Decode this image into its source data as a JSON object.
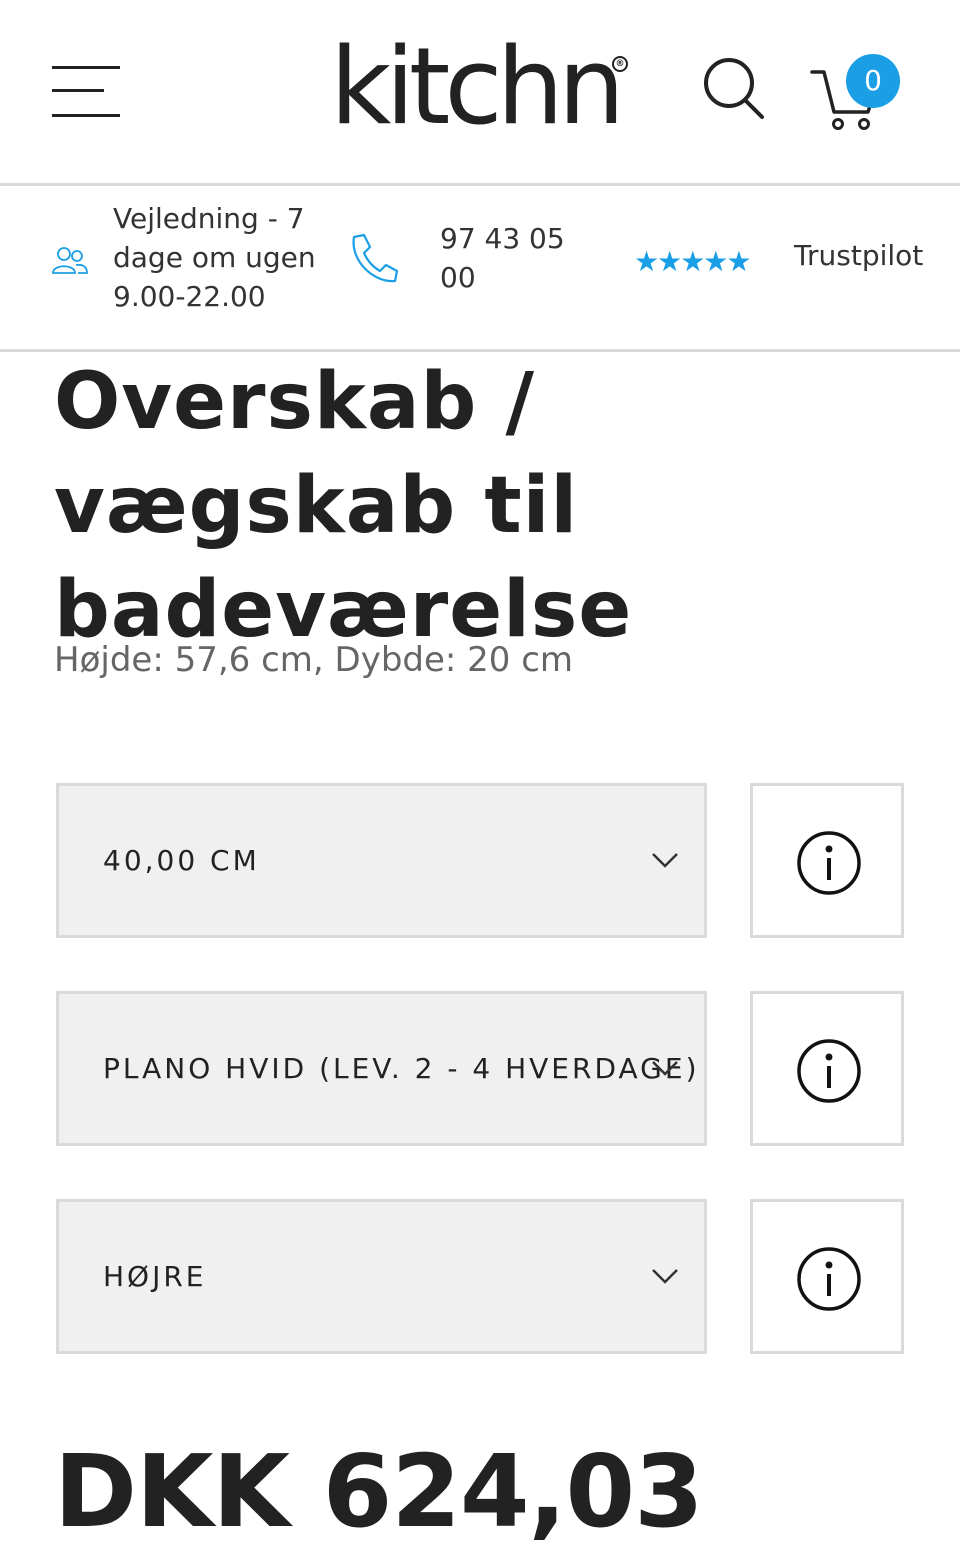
{
  "header": {
    "logo_text": "kitchn",
    "logo_mark": "®",
    "cart_count": "0",
    "icons": [
      "hamburger-menu-icon",
      "search-icon",
      "cart-icon"
    ]
  },
  "infobar": {
    "guide_text": "Vejledning - 7 dage om ugen 9.00-22.00",
    "phone": "97 43 05 00",
    "stars": "★★★★★",
    "trustpilot_label": "Trustpilot",
    "icons": [
      "people-icon",
      "phone-icon",
      "star-icon"
    ]
  },
  "product": {
    "title": "Overskab / vægskab til badeværelse",
    "dimensions": "Højde: 57,6 cm, Dybde: 20 cm",
    "price": "DKK 624,03"
  },
  "options": [
    {
      "value": "40,00 CM"
    },
    {
      "value": "PLANO HVID (LEV. 2 - 4 HVERDAGE)"
    },
    {
      "value": "HØJRE"
    }
  ],
  "colors": {
    "accent": "#1a9ee6",
    "text": "#222222",
    "muted": "#666666",
    "select_bg": "#f0f0f0",
    "border": "#dadada"
  }
}
